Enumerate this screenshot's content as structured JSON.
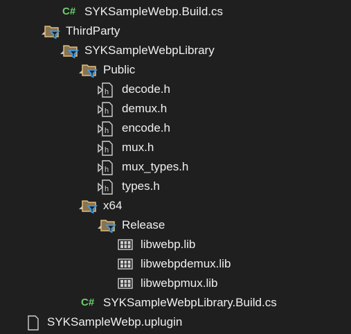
{
  "tree": [
    {
      "label": "SYKSampleWebp.Build.cs",
      "level": 2,
      "type": "csharp",
      "icon_text": "C#"
    },
    {
      "label": "ThirdParty",
      "level": 1,
      "type": "filter-folder",
      "expanded": true
    },
    {
      "label": "SYKSampleWebpLibrary",
      "level": 2,
      "type": "filter-folder",
      "expanded": true
    },
    {
      "label": "Public",
      "level": 3,
      "type": "filter-folder",
      "expanded": true
    },
    {
      "label": "decode.h",
      "level": 4,
      "type": "header",
      "expanded": false
    },
    {
      "label": "demux.h",
      "level": 4,
      "type": "header",
      "expanded": false
    },
    {
      "label": "encode.h",
      "level": 4,
      "type": "header",
      "expanded": false
    },
    {
      "label": "mux.h",
      "level": 4,
      "type": "header",
      "expanded": false
    },
    {
      "label": "mux_types.h",
      "level": 4,
      "type": "header",
      "expanded": false
    },
    {
      "label": "types.h",
      "level": 4,
      "type": "header",
      "expanded": false
    },
    {
      "label": "x64",
      "level": 3,
      "type": "filter-folder",
      "expanded": true
    },
    {
      "label": "Release",
      "level": 4,
      "type": "filter-folder",
      "expanded": true
    },
    {
      "label": "libwebp.lib",
      "level": 5,
      "type": "library"
    },
    {
      "label": "libwebpdemux.lib",
      "level": 5,
      "type": "library"
    },
    {
      "label": "libwebpmux.lib",
      "level": 5,
      "type": "library"
    },
    {
      "label": "SYKSampleWebpLibrary.Build.cs",
      "level": 3,
      "type": "csharp",
      "icon_text": "C#"
    },
    {
      "label": "SYKSampleWebp.uplugin",
      "level": 0,
      "type": "file"
    }
  ],
  "colors": {
    "background": "#1f1f1f",
    "text": "#f0f0f0",
    "csharp": "#6ccf6c",
    "folder": "#d8b46a",
    "filter": "#3c9be8"
  }
}
